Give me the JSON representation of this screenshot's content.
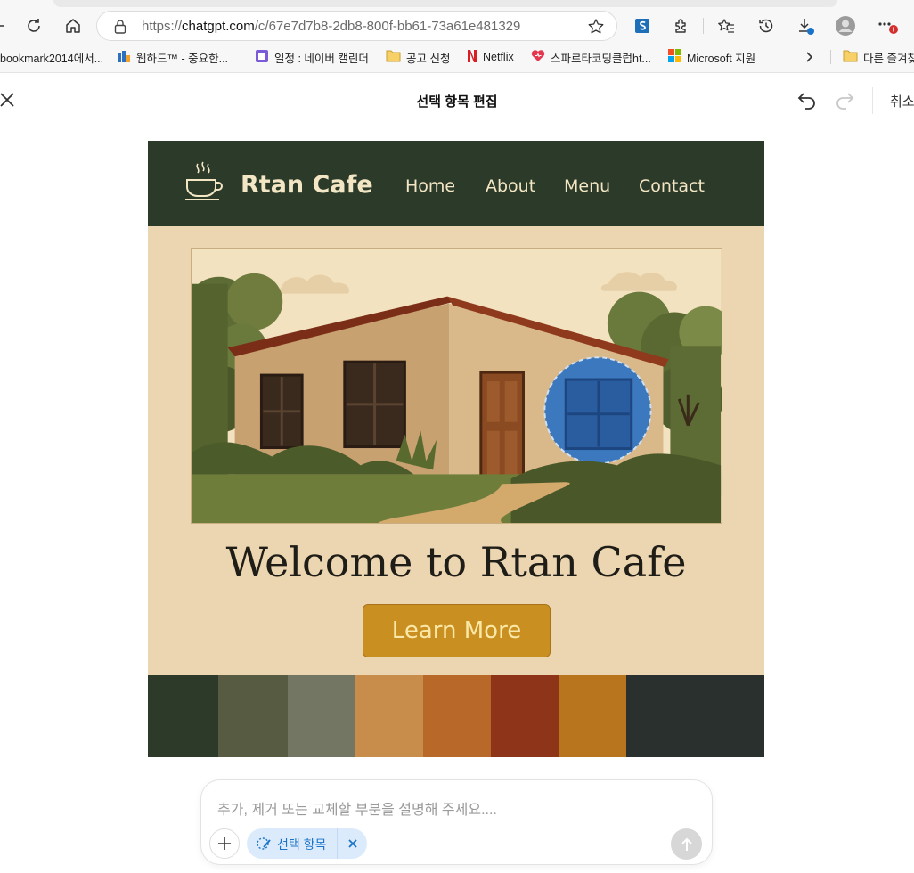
{
  "browser": {
    "url_prefix": "https://",
    "url_host": "chatgpt.com",
    "url_path": "/c/67e7d7b8-2db8-800f-bb61-73a61e481329",
    "bookmarks": [
      {
        "label": "bookmark2014에서..."
      },
      {
        "label": "웹하드™ - 중요한..."
      },
      {
        "label": "일정 : 네이버 캘린더"
      },
      {
        "label": "공고 신청"
      },
      {
        "label": "Netflix"
      },
      {
        "label": "스파르타코딩클럽ht..."
      },
      {
        "label": "Microsoft 지원"
      },
      {
        "label": "다른 즐겨찾기"
      }
    ]
  },
  "editor": {
    "title": "선택 항목 편집",
    "cancel_label": "취소"
  },
  "site": {
    "brand": "Rtan Cafe",
    "nav": [
      "Home",
      "About",
      "Menu",
      "Contact"
    ],
    "headline": "Welcome to Rtan Cafe",
    "cta": "Learn More",
    "palette": [
      "#2d3a2a",
      "#575b42",
      "#737662",
      "#c98d4b",
      "#b8692a",
      "#8e3519",
      "#b9751e",
      "#29302d"
    ]
  },
  "composer": {
    "placeholder": "추가, 제거 또는 교체할 부분을 설명해 주세요....",
    "chip_label": "선택 항목"
  },
  "colors": {
    "accent_blue": "#1a73c9",
    "selection_fill": "#2f6fb8",
    "button_gold": "#c99021"
  }
}
